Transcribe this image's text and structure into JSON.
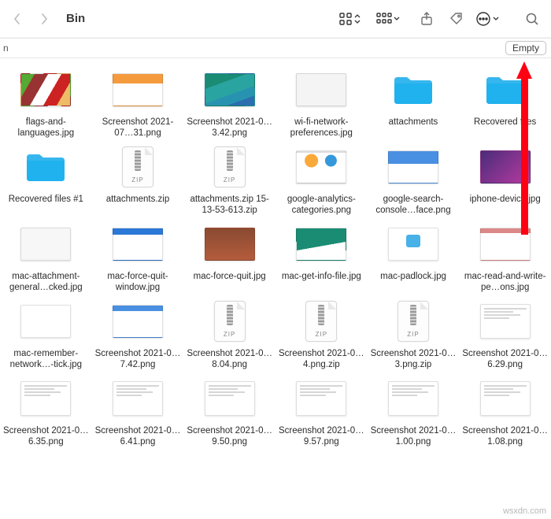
{
  "toolbar": {
    "title": "Bin"
  },
  "subbar": {
    "path_fragment": "n",
    "empty_label": "Empty"
  },
  "items": [
    {
      "label": "flags-and-languages.jpg",
      "kind": "img",
      "variant": "tv-flags"
    },
    {
      "label": "Screenshot 2021-07…31.png",
      "kind": "img",
      "variant": "tv-shot1"
    },
    {
      "label": "Screenshot 2021-0…3.42.png",
      "kind": "img",
      "variant": "tv-desktop"
    },
    {
      "label": "wi-fi-network-preferences.jpg",
      "kind": "img",
      "variant": "tv-wifi"
    },
    {
      "label": "attachments",
      "kind": "folder"
    },
    {
      "label": "Recovered files",
      "kind": "folder"
    },
    {
      "label": "Recovered files #1",
      "kind": "folder"
    },
    {
      "label": "attachments.zip",
      "kind": "zip"
    },
    {
      "label": "attachments.zip 15-13-53-613.zip",
      "kind": "zip"
    },
    {
      "label": "google-analytics-categories.png",
      "kind": "img",
      "variant": "tv-ga"
    },
    {
      "label": "google-search-console…face.png",
      "kind": "img",
      "variant": "tv-gsc"
    },
    {
      "label": "iphone-device.jpg",
      "kind": "img",
      "variant": "tv-iphone"
    },
    {
      "label": "mac-attachment-general…cked.jpg",
      "kind": "img",
      "variant": "tv-attach"
    },
    {
      "label": "mac-force-quit-window.jpg",
      "kind": "img",
      "variant": "tv-fq"
    },
    {
      "label": "mac-force-quit.jpg",
      "kind": "img",
      "variant": "tv-brick"
    },
    {
      "label": "mac-get-info-file.jpg",
      "kind": "img",
      "variant": "tv-getinfo"
    },
    {
      "label": "mac-padlock.jpg",
      "kind": "img",
      "variant": "tv-padlock"
    },
    {
      "label": "mac-read-and-write-pe…ons.jpg",
      "kind": "img",
      "variant": "tv-perm"
    },
    {
      "label": "mac-remember-network…-tick.jpg",
      "kind": "img",
      "variant": "tv-rem"
    },
    {
      "label": "Screenshot 2021-0…7.42.png",
      "kind": "img",
      "variant": "tv-dlg"
    },
    {
      "label": "Screenshot 2021-0…8.04.png",
      "kind": "zip"
    },
    {
      "label": "Screenshot 2021-0…4.png.zip",
      "kind": "zip"
    },
    {
      "label": "Screenshot 2021-0…3.png.zip",
      "kind": "zip"
    },
    {
      "label": "Screenshot 2021-0…6.29.png",
      "kind": "doc"
    },
    {
      "label": "Screenshot 2021-0…6.35.png",
      "kind": "doc"
    },
    {
      "label": "Screenshot 2021-0…6.41.png",
      "kind": "doc"
    },
    {
      "label": "Screenshot 2021-0…9.50.png",
      "kind": "doc"
    },
    {
      "label": "Screenshot 2021-0…9.57.png",
      "kind": "doc"
    },
    {
      "label": "Screenshot 2021-0…1.00.png",
      "kind": "doc"
    },
    {
      "label": "Screenshot 2021-0…1.08.png",
      "kind": "doc"
    }
  ],
  "watermark": "wsxdn.com",
  "zip_label": "ZIP"
}
